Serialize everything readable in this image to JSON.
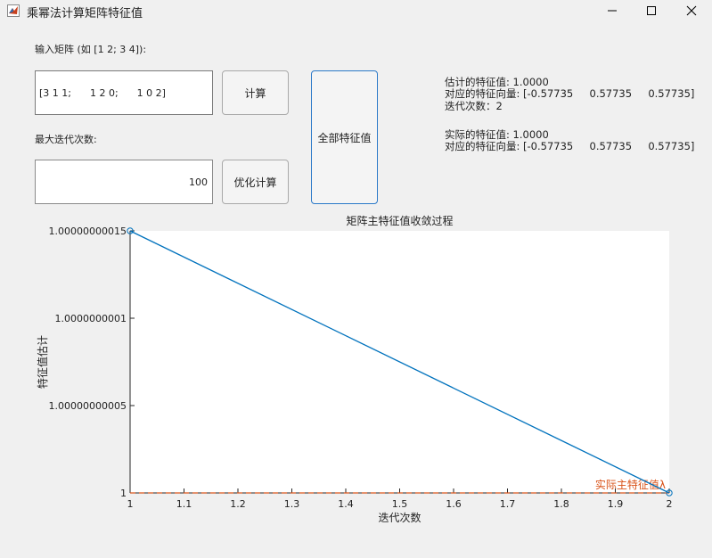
{
  "window": {
    "title": "乘幂法计算矩阵特征值",
    "icons": [
      "matlab-icon",
      "minimize-icon",
      "maximize-icon",
      "close-icon"
    ]
  },
  "inputs": {
    "matrix_label": "输入矩阵 (如 [1 2; 3 4]):",
    "matrix_value": "[3 1 1;      1 2 0;      1 0 2]",
    "iter_label": "最大迭代次数:",
    "iter_value": "100"
  },
  "buttons": {
    "compute": "计算",
    "optimize": "优化计算",
    "all_eigen": "全部特征值"
  },
  "results": {
    "est_value": "估计的特征值: 1.0000",
    "est_vector": "对应的特征向量: [-0.57735     0.57735     0.57735]",
    "iterations": "迭代次数：2",
    "act_value": "实际的特征值: 1.0000",
    "act_vector": "对应的特征向量: [-0.57735     0.57735     0.57735]"
  },
  "chart_data": {
    "type": "line",
    "title": "矩阵主特征值收敛过程",
    "xlabel": "迭代次数",
    "ylabel": "特征值估计",
    "xlim": [
      1,
      2
    ],
    "ylim": [
      1,
      1.00000000015
    ],
    "xticks": [
      "1",
      "1.1",
      "1.2",
      "1.3",
      "1.4",
      "1.5",
      "1.6",
      "1.7",
      "1.8",
      "1.9",
      "2"
    ],
    "yticks": [
      "1",
      "1.00000000005",
      "1.0000000001",
      "1.00000000015"
    ],
    "series": [
      {
        "x": [
          1,
          2
        ],
        "y": [
          1.00000000015,
          1
        ],
        "color": "#0072bd",
        "marker": "circle"
      }
    ],
    "reference_line": {
      "y": 1,
      "color": "#d95319",
      "label": "实际主特征值λ"
    },
    "grid": false
  }
}
